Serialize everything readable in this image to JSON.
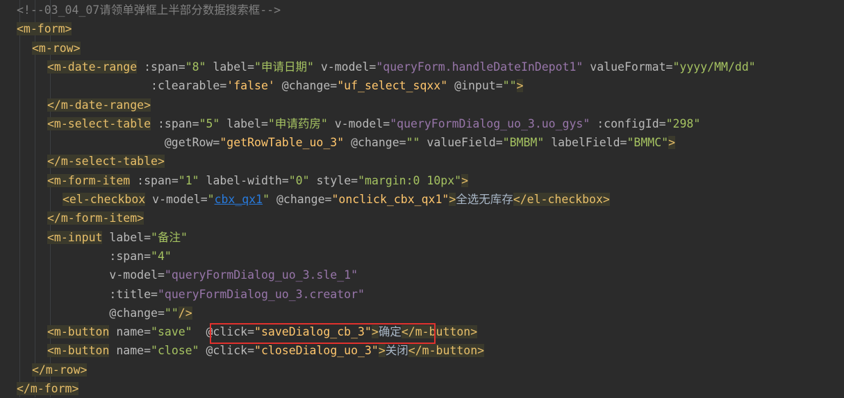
{
  "editor": {
    "lines": [
      [
        {
          "t": "<!--03_04_07请领单弹框上半部分数据搜索框-->",
          "c": "comment"
        }
      ],
      [
        {
          "t": "<m-form",
          "c": "tag"
        },
        {
          "t": ">",
          "c": "tag"
        }
      ],
      [
        {
          "t": "<m-row",
          "c": "tag"
        },
        {
          "t": ">",
          "c": "tag"
        }
      ],
      [
        {
          "t": "<m-date-range",
          "c": "tag"
        },
        {
          "t": " :span=",
          "c": "attr"
        },
        {
          "t": "\"8\"",
          "c": "strgreen"
        },
        {
          "t": " label=",
          "c": "attr"
        },
        {
          "t": "\"申请日期\"",
          "c": "strgreen"
        },
        {
          "t": " v-model=",
          "c": "attr"
        },
        {
          "t": "\"queryForm.handleDateInDepot1\"",
          "c": "var"
        },
        {
          "t": " valueFormat=",
          "c": "attr"
        },
        {
          "t": "\"yyyy/MM/dd\"",
          "c": "strgreen"
        }
      ],
      [
        {
          "t": "               :clearable=",
          "c": "attr"
        },
        {
          "t": "'false'",
          "c": "fn"
        },
        {
          "t": " @change=",
          "c": "attr"
        },
        {
          "t": "\"uf_select_sqxx\"",
          "c": "fn"
        },
        {
          "t": " @input=",
          "c": "attr"
        },
        {
          "t": "\"\"",
          "c": "strgreen"
        },
        {
          "t": ">",
          "c": "tag"
        }
      ],
      [
        {
          "t": "</m-date-range>",
          "c": "tag"
        }
      ],
      [
        {
          "t": "<m-select-table",
          "c": "tag"
        },
        {
          "t": " :span=",
          "c": "attr"
        },
        {
          "t": "\"5\"",
          "c": "strgreen"
        },
        {
          "t": " label=",
          "c": "attr"
        },
        {
          "t": "\"申请药房\"",
          "c": "strgreen"
        },
        {
          "t": " v-model=",
          "c": "attr"
        },
        {
          "t": "\"queryFormDialog_uo_3.uo_gys\"",
          "c": "var"
        },
        {
          "t": " :configId=",
          "c": "attr"
        },
        {
          "t": "\"298\"",
          "c": "strgreen"
        }
      ],
      [
        {
          "t": "                 @getRow=",
          "c": "attr"
        },
        {
          "t": "\"getRowTable_uo_3\"",
          "c": "fn"
        },
        {
          "t": " @change=",
          "c": "attr"
        },
        {
          "t": "\"\"",
          "c": "strgreen"
        },
        {
          "t": " valueField=",
          "c": "attr"
        },
        {
          "t": "\"BMBM\"",
          "c": "strgreen"
        },
        {
          "t": " labelField=",
          "c": "attr"
        },
        {
          "t": "\"BMMC\"",
          "c": "strgreen"
        },
        {
          "t": ">",
          "c": "tag"
        }
      ],
      [
        {
          "t": "</m-select-table>",
          "c": "tag"
        }
      ],
      [
        {
          "t": "<m-form-item",
          "c": "tag"
        },
        {
          "t": " :span=",
          "c": "attr"
        },
        {
          "t": "\"1\"",
          "c": "strgreen"
        },
        {
          "t": " label-width=",
          "c": "attr"
        },
        {
          "t": "\"0\"",
          "c": "strgreen"
        },
        {
          "t": " style=",
          "c": "attr"
        },
        {
          "t": "\"margin:0 10px\"",
          "c": "strgreen"
        },
        {
          "t": ">",
          "c": "tag"
        }
      ],
      [
        {
          "t": "<el-checkbox",
          "c": "tag"
        },
        {
          "t": " v-model=",
          "c": "attr"
        },
        {
          "t": "\"",
          "c": "strgreen"
        },
        {
          "t": "cbx_qx1",
          "c": "link"
        },
        {
          "t": "\"",
          "c": "strgreen"
        },
        {
          "t": " @change=",
          "c": "attr"
        },
        {
          "t": "\"onclick_cbx_qx1\"",
          "c": "fn"
        },
        {
          "t": ">",
          "c": "tag"
        },
        {
          "t": "全选无库存",
          "c": "plain"
        },
        {
          "t": "</el-checkbox>",
          "c": "tag"
        }
      ],
      [
        {
          "t": "</m-form-item>",
          "c": "tag"
        }
      ],
      [
        {
          "t": "<m-input",
          "c": "tag"
        },
        {
          "t": " label=",
          "c": "attr"
        },
        {
          "t": "\"备注\"",
          "c": "strgreen"
        }
      ],
      [
        {
          "t": "         :span=",
          "c": "attr"
        },
        {
          "t": "\"4\"",
          "c": "strgreen"
        }
      ],
      [
        {
          "t": "         v-model=",
          "c": "attr"
        },
        {
          "t": "\"queryFormDialog_uo_3.sle_1\"",
          "c": "var"
        }
      ],
      [
        {
          "t": "         :title=",
          "c": "attr"
        },
        {
          "t": "\"queryFormDialog_uo_3.creator\"",
          "c": "var"
        }
      ],
      [
        {
          "t": "         @change=",
          "c": "attr"
        },
        {
          "t": "\"\"",
          "c": "strgreen"
        },
        {
          "t": "/>",
          "c": "tag"
        }
      ],
      [
        {
          "t": "<m-button",
          "c": "tag"
        },
        {
          "t": " name=",
          "c": "attr"
        },
        {
          "t": "\"save\"",
          "c": "strgreen"
        },
        {
          "t": "  @click=",
          "c": "attr"
        },
        {
          "t": "\"saveDialog_cb_3\"",
          "c": "fn"
        },
        {
          "t": ">",
          "c": "tag"
        },
        {
          "t": "确定",
          "c": "plain"
        },
        {
          "t": "</m-button>",
          "c": "tag"
        }
      ],
      [
        {
          "t": "<m-button",
          "c": "tag"
        },
        {
          "t": " name=",
          "c": "attr"
        },
        {
          "t": "\"close\"",
          "c": "strgreen"
        },
        {
          "t": " @click=",
          "c": "attr"
        },
        {
          "t": "\"closeDialog_uo_3\"",
          "c": "fn"
        },
        {
          "t": ">",
          "c": "tag"
        },
        {
          "t": "关闭",
          "c": "plain"
        },
        {
          "t": "</m-button>",
          "c": "tag"
        }
      ],
      [
        {
          "t": "</m-row>",
          "c": "tag"
        }
      ],
      [
        {
          "t": "</m-form>",
          "c": "tag"
        }
      ]
    ]
  },
  "colors": {
    "background": "#2b2b2b",
    "highlight_border": "#e2312d"
  }
}
